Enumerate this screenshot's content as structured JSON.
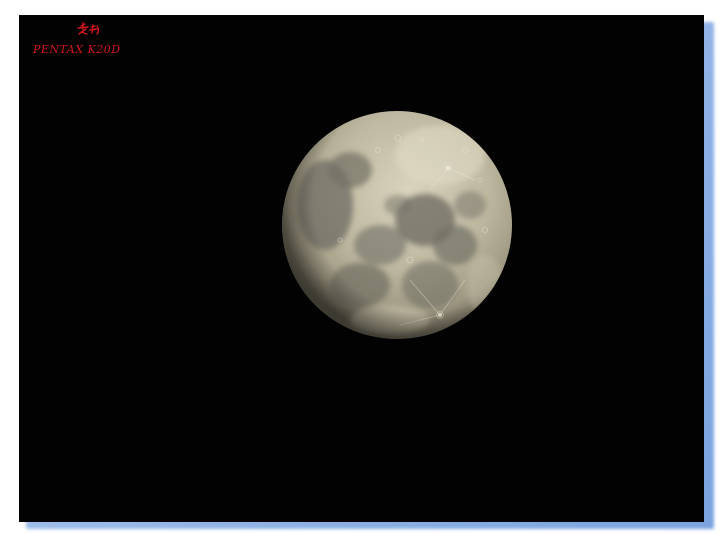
{
  "image": {
    "subject": "moon-photo",
    "frame_color": "#8fb2e6",
    "background_color": "#020202",
    "watermark": {
      "signature": "老狐",
      "camera": "PENTAX K20D",
      "color": "#d01818"
    }
  }
}
